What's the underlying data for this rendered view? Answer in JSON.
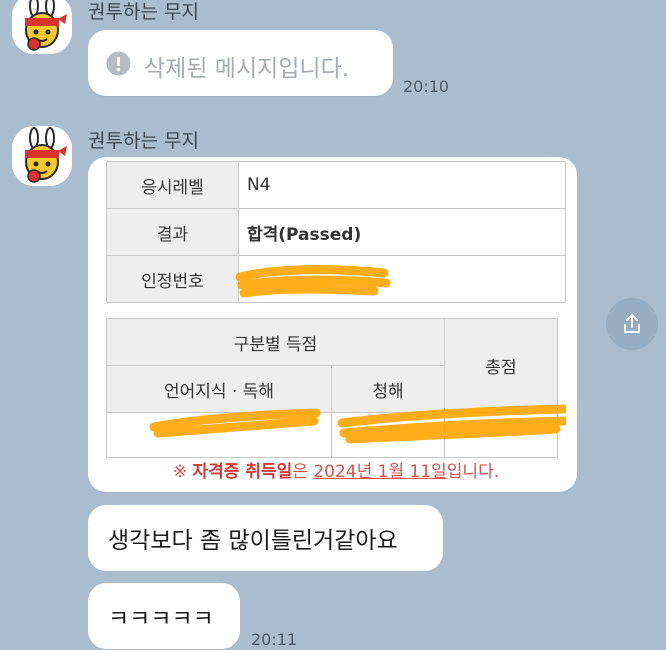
{
  "chat": {
    "sender_name": "권투하는 무지",
    "messages": [
      {
        "deleted_text": "삭제된 메시지입니다.",
        "time": "20:10"
      },
      {
        "type": "image"
      },
      {
        "text": "생각보다 좀 많이틀린거같아요"
      },
      {
        "text": "ㅋㅋㅋㅋㅋ",
        "time": "20:11"
      }
    ]
  },
  "result_image": {
    "rows": [
      {
        "label": "응시레벨",
        "value": "N4"
      },
      {
        "label": "결과",
        "value": "합격(Passed)"
      },
      {
        "label": "인정번호",
        "value": ""
      }
    ],
    "score_header": "구분별 득점",
    "score_total": "총점",
    "score_cols": [
      "언어지식 · 독해",
      "청해"
    ],
    "notice_prefix": "※ ",
    "notice_bold": "자격증 취득일",
    "notice_mid": "은 ",
    "notice_date": "2024년 1월 11일",
    "notice_suffix": "입니다."
  },
  "icons": {
    "avatar": "muzi-boxing-avatar",
    "deleted": "info-icon",
    "share": "share-icon"
  },
  "colors": {
    "background": "#a9bdce",
    "bubble": "#ffffff",
    "notice_red": "#d43a35",
    "scribble": "#ffa500"
  }
}
